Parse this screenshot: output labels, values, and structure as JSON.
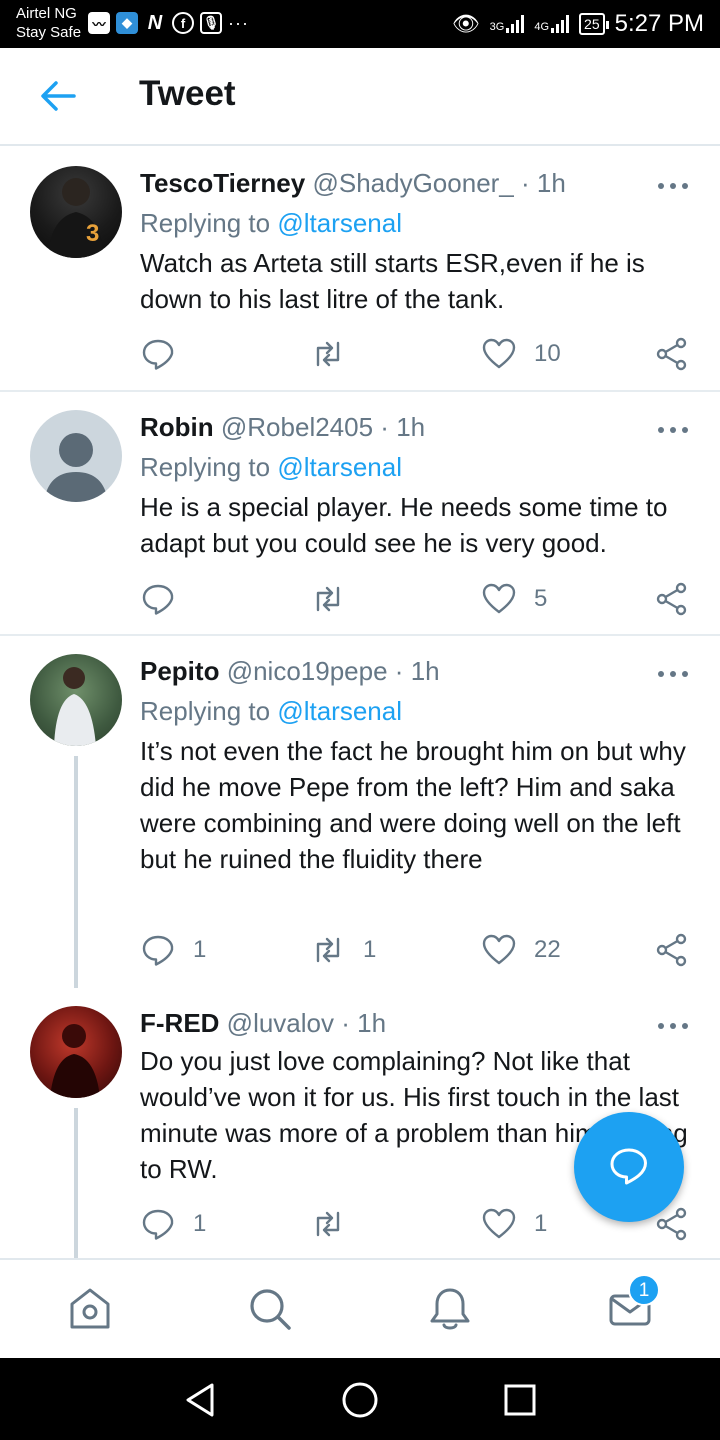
{
  "status_bar": {
    "carrier": "Airtel NG",
    "carrier_sub": "Stay Safe",
    "net1": "3G",
    "net2": "4G",
    "battery": "25",
    "time": "5:27 PM"
  },
  "header": {
    "title": "Tweet"
  },
  "tweets": [
    {
      "name": "TescoTierney",
      "handle": "@ShadyGooner_",
      "sep": "·",
      "time": "1h",
      "replying_prefix": "Replying to",
      "mention": "@ltarsenal",
      "text": "Watch as Arteta still starts ESR,even if he is down to his last litre of the tank.",
      "replies": "",
      "retweets": "",
      "likes": "10"
    },
    {
      "name": "Robin",
      "handle": "@Robel2405",
      "sep": "·",
      "time": "1h",
      "replying_prefix": "Replying to",
      "mention": "@ltarsenal",
      "text": "He is a special player. He needs some time to adapt but you could see he is very good.",
      "replies": "",
      "retweets": "",
      "likes": "5"
    },
    {
      "name": "Pepito",
      "handle": "@nico19pepe",
      "sep": "·",
      "time": "1h",
      "replying_prefix": "Replying to",
      "mention": "@ltarsenal",
      "text": "It’s not even the fact he brought him on but why did he move Pepe from the left? Him and saka were combining and were doing well on the left but he ruined the fluidity there",
      "replies": "1",
      "retweets": "1",
      "likes": "22"
    },
    {
      "name": "F-RED",
      "handle": "@luvalov",
      "sep": "·",
      "time": "1h",
      "text": "Do you just love complaining? Not like that would’ve won it for us. His first touch in the last minute was more of a problem than him moving to RW.",
      "replies": "1",
      "retweets": "",
      "likes": "1"
    }
  ],
  "bottom_nav": {
    "messages_badge": "1"
  },
  "colors": {
    "accent": "#1da1f2",
    "text": "#14171a",
    "muted": "#657786",
    "divider": "#e6ecf0"
  },
  "icons": [
    "back-arrow-icon",
    "more-icon",
    "reply-icon",
    "retweet-icon",
    "like-icon",
    "share-icon",
    "compose-icon",
    "home-icon",
    "search-icon",
    "notifications-icon",
    "messages-icon",
    "back-triangle-icon",
    "home-circle-icon",
    "recents-square-icon"
  ]
}
